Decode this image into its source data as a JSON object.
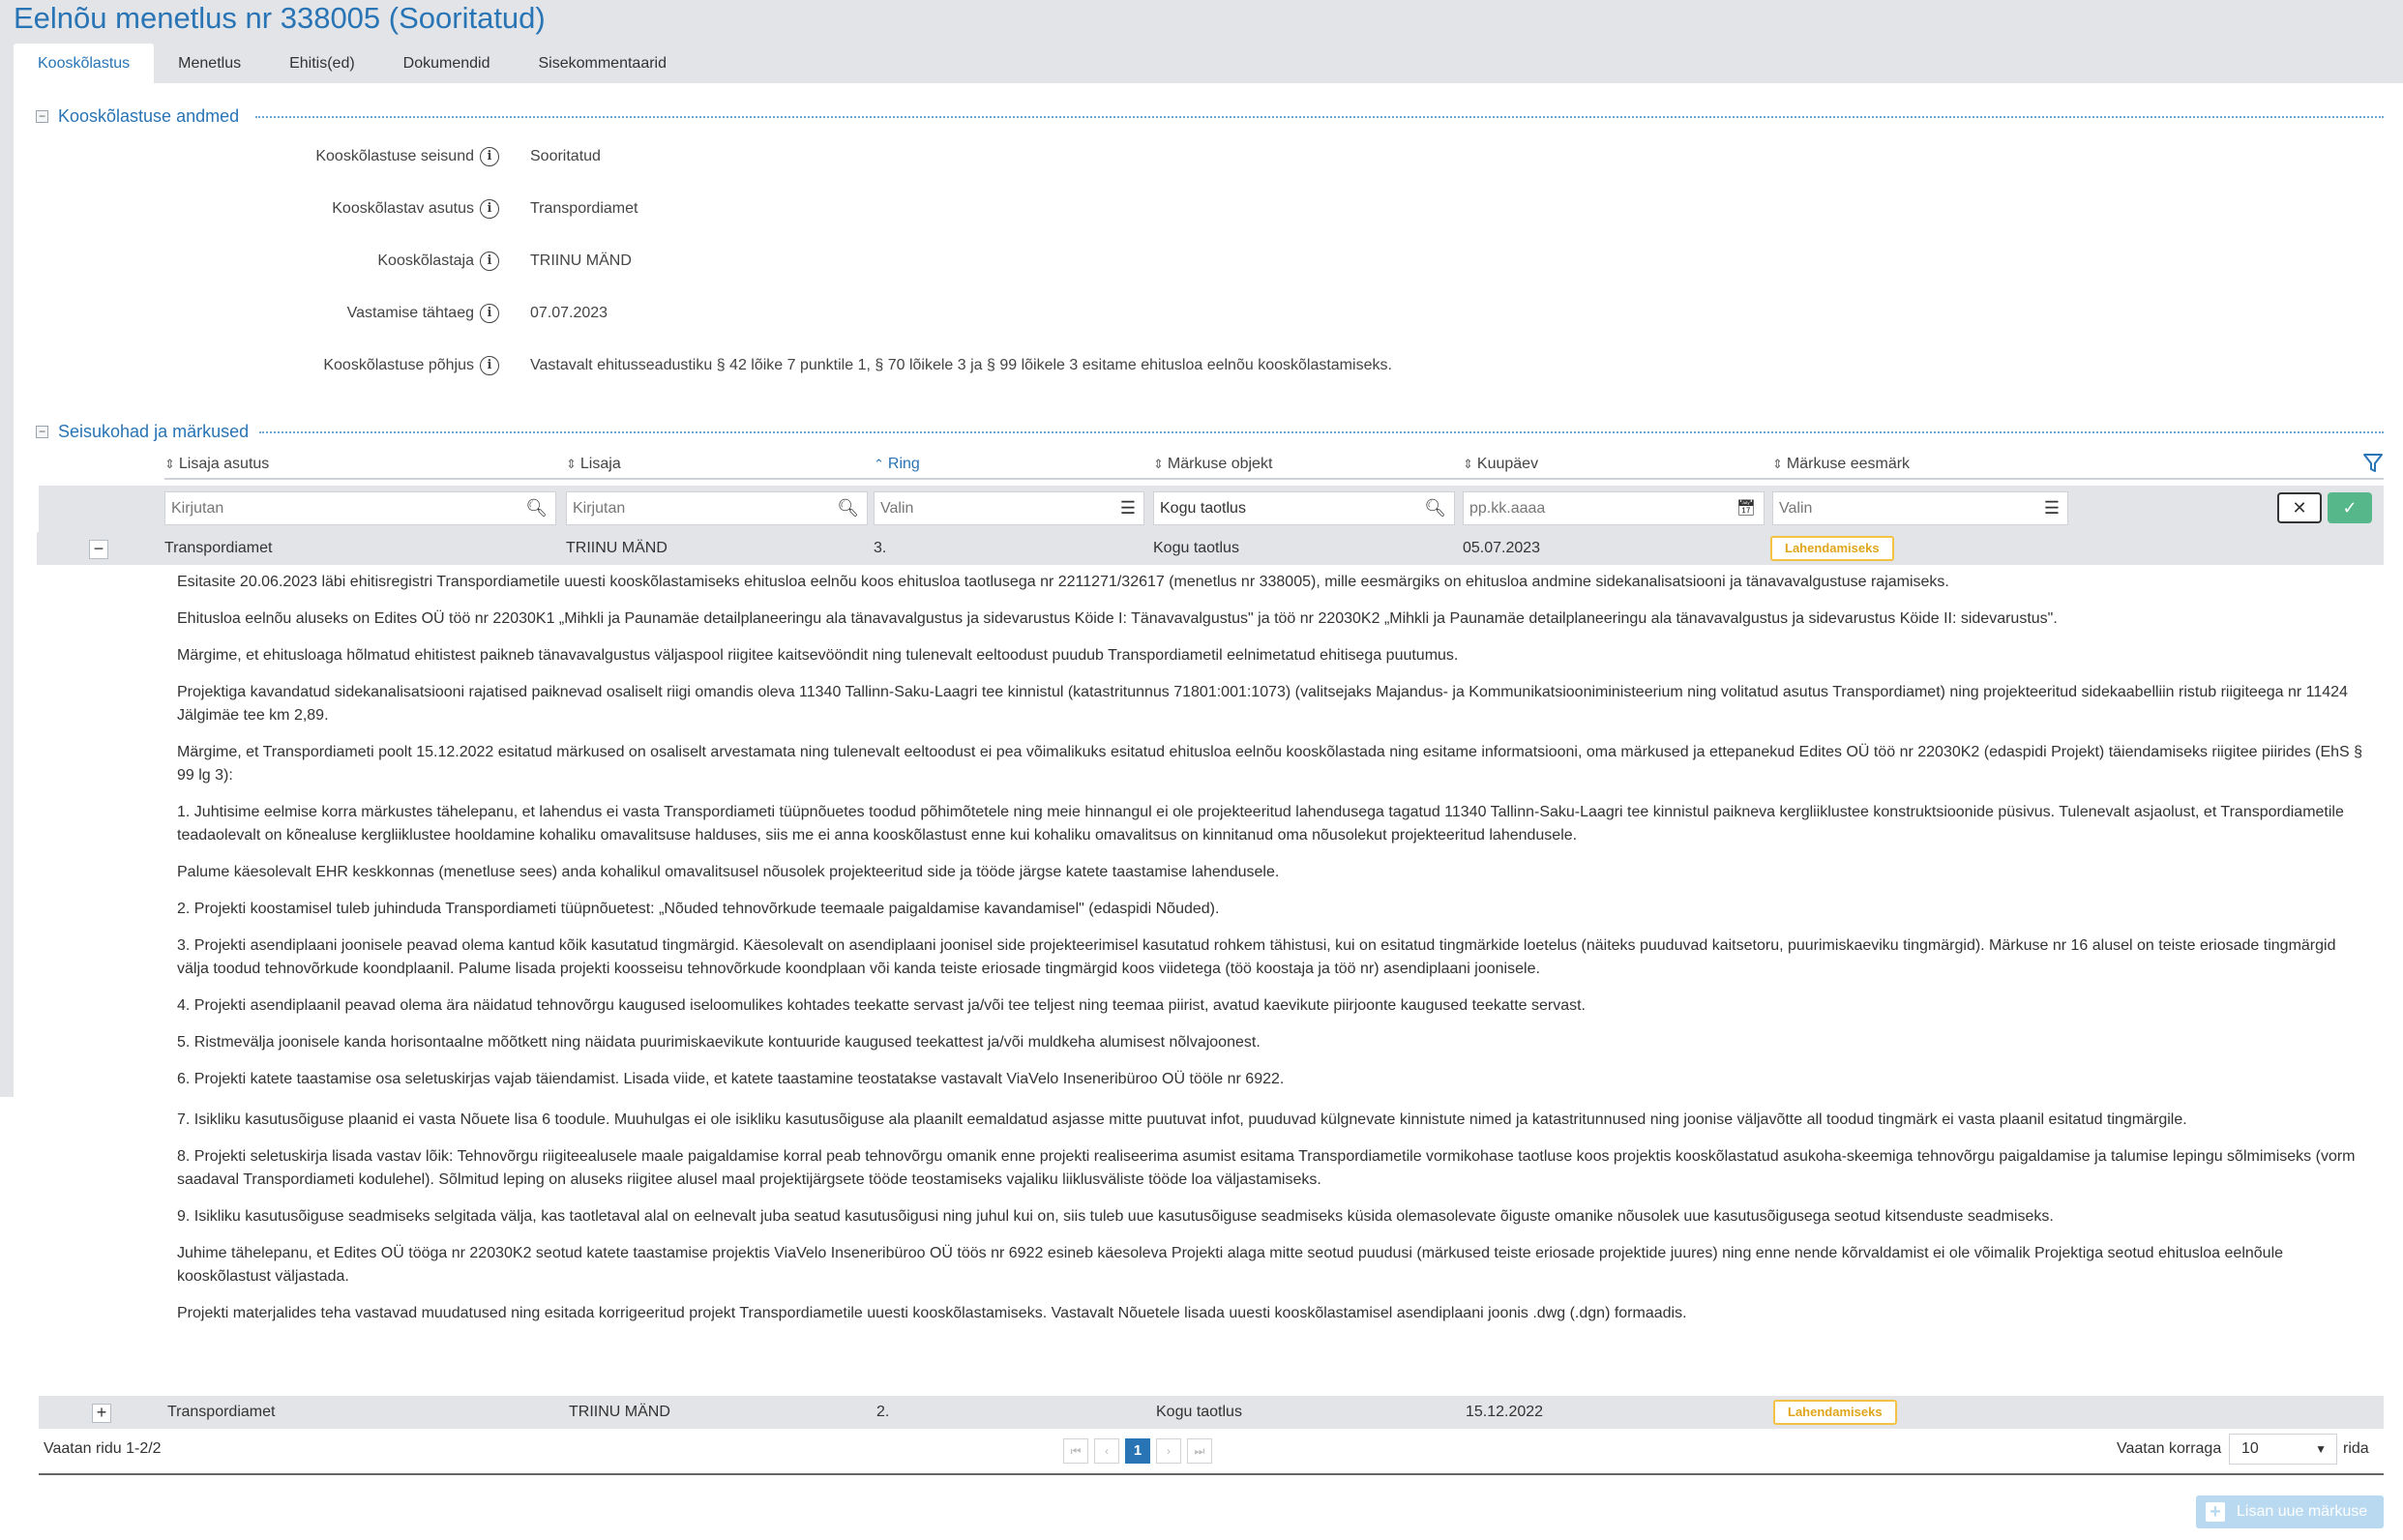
{
  "header": {
    "title": "Eelnõu menetlus nr 338005 (Sooritatud)",
    "tabs": [
      "Kooskõlastus",
      "Menetlus",
      "Ehitis(ed)",
      "Dokumendid",
      "Sisekommentaarid"
    ]
  },
  "section1": {
    "title": "Kooskõlastuse andmed",
    "toggle": "−",
    "fields": [
      {
        "label": "Kooskõlastuse seisund",
        "value": "Sooritatud"
      },
      {
        "label": "Kooskõlastav asutus",
        "value": "Transpordiamet"
      },
      {
        "label": "Kooskõlastaja",
        "value": "TRIINU MÄND"
      },
      {
        "label": "Vastamise tähtaeg",
        "value": "07.07.2023"
      },
      {
        "label": "Kooskõlastuse põhjus",
        "value": "Vastavalt ehitusseadustiku § 42 lõike 7 punktile 1, § 70 lõikele 3 ja § 99 lõikele 3 esitame ehitusloa eelnõu kooskõlastamiseks."
      }
    ],
    "info_icon": "i"
  },
  "section2": {
    "title": "Seisukohad ja märkused",
    "toggle": "−",
    "columns": [
      {
        "label": "Lisaja asutus",
        "sort": "⇕"
      },
      {
        "label": "Lisaja",
        "sort": "⇕"
      },
      {
        "label": "Ring",
        "sort": "⌃"
      },
      {
        "label": "Märkuse objekt",
        "sort": "⇕"
      },
      {
        "label": "Kuupäev",
        "sort": "⇕"
      },
      {
        "label": "Märkuse eesmärk",
        "sort": "⇕"
      }
    ],
    "filters": [
      {
        "placeholder": "Kirjutan",
        "icon": "search-icon"
      },
      {
        "placeholder": "Kirjutan",
        "icon": "search-icon"
      },
      {
        "placeholder": "Valin",
        "icon": "list-icon"
      },
      {
        "placeholder": "Kogu taotlus",
        "icon": "search-icon"
      },
      {
        "placeholder": "pp.kk.aaaa",
        "icon": "calendar-icon"
      },
      {
        "placeholder": "Valin",
        "icon": "list-icon"
      }
    ],
    "rows": [
      {
        "toggle": "−",
        "asutus": "Transpordiamet",
        "lisaja": "TRIINU MÄND",
        "ring": "3.",
        "objekt": "Kogu taotlus",
        "kuupaev": "05.07.2023",
        "eesmark": "Lahendamiseks"
      },
      {
        "toggle": "+",
        "asutus": "Transpordiamet",
        "lisaja": "TRIINU MÄND",
        "ring": "2.",
        "objekt": "Kogu taotlus",
        "kuupaev": "15.12.2022",
        "eesmark": "Lahendamiseks"
      }
    ],
    "detail": [
      "Esitasite 20.06.2023 läbi ehitisregistri Transpordiametile uuesti kooskõlastamiseks ehitusloa eelnõu koos ehitusloa taotlusega nr 2211271/32617 (menetlus nr 338005), mille eesmärgiks on ehitusloa andmine sidekanalisatsiooni ja tänavavalgustuse rajamiseks.",
      "Ehitusloa eelnõu aluseks on Edites OÜ töö nr 22030K1 „Mihkli ja Paunamäe detailplaneeringu ala tänavavalgustus ja sidevarustus Köide I: Tänavavalgustus\" ja töö nr 22030K2 „Mihkli ja Paunamäe detailplaneeringu ala tänavavalgustus ja sidevarustus Köide II: sidevarustus\".",
      "Märgime, et ehitusloaga hõlmatud ehitistest paikneb tänavavalgustus väljaspool riigitee kaitsevööndit ning tulenevalt eeltoodust puudub Transpordiametil eelnimetatud ehitisega puutumus.",
      "Projektiga kavandatud sidekanalisatsiooni rajatised paiknevad osaliselt riigi omandis oleva 11340 Tallinn-Saku-Laagri tee kinnistul (katastritunnus 71801:001:1073) (valitsejaks Majandus- ja Kommunikatsiooniministeerium ning volitatud asutus Transpordiamet) ning projekteeritud sidekaabelliin ristub riigiteega nr 11424 Jälgimäe tee km 2,89.",
      "Märgime, et Transpordiameti poolt 15.12.2022 esitatud märkused on osaliselt arvestamata ning tulenevalt eeltoodust ei pea võimalikuks esitatud ehitusloa eelnõu kooskõlastada ning esitame informatsiooni, oma märkused ja ettepanekud Edites OÜ töö nr 22030K2 (edaspidi Projekt) täiendamiseks riigitee piirides (EhS § 99 lg 3):",
      "1. Juhtisime eelmise korra märkustes tähelepanu, et lahendus ei vasta Transpordiameti tüüpnõuetes toodud põhimõtetele ning meie hinnangul ei ole projekteeritud lahendusega tagatud 11340 Tallinn-Saku-Laagri tee kinnistul paikneva kergliiklustee konstruktsioonide püsivus. Tulenevalt asjaolust, et Transpordiametile teadaolevalt on kõnealuse kergliiklustee hooldamine kohaliku omavalitsuse halduses, siis me ei anna kooskõlastust enne kui kohaliku omavalitsus on kinnitanud oma nõusolekut projekteeritud lahendusele.",
      "Palume käesolevalt EHR keskkonnas (menetluse sees) anda kohalikul omavalitsusel nõusolek projekteeritud side ja tööde järgse katete taastamise lahendusele.",
      "2. Projekti koostamisel tuleb juhinduda Transpordiameti tüüpnõuetest: „Nõuded tehnovõrkude teemaale paigaldamise kavandamisel\" (edaspidi Nõuded).",
      "3. Projekti asendiplaani joonisele peavad olema kantud kõik kasutatud tingmärgid. Käesolevalt on asendiplaani joonisel side projekteerimisel kasutatud rohkem tähistusi, kui on esitatud tingmärkide loetelus (näiteks puuduvad kaitsetoru, puurimiskaeviku tingmärgid). Märkuse nr 16 alusel on teiste eriosade tingmärgid välja toodud tehnovõrkude koondplaanil. Palume lisada projekti koosseisu tehnovõrkude koondplaan või kanda teiste eriosade tingmärgid koos viidetega (töö koostaja ja töö nr) asendiplaani joonisele.",
      "4. Projekti asendiplaanil peavad olema ära näidatud tehnovõrgu kaugused iseloomulikes kohtades teekatte servast ja/või tee teljest ning teemaa piirist, avatud kaevikute piirjoonte kaugused teekatte servast.",
      "5. Ristmevälja joonisele kanda horisontaalne mõõtkett ning näidata puurimiskaevikute kontuuride kaugused teekattest ja/või muldkeha alumisest nõlvajoonest.",
      "6. Projekti katete taastamise osa seletuskirjas vajab täiendamist. Lisada viide, et katete taastamine teostatakse vastavalt ViaVelo Inseneribüroo OÜ tööle nr 6922.",
      "7. Isikliku kasutusõiguse plaanid ei vasta Nõuete lisa 6 toodule. Muuhulgas ei ole isikliku kasutusõiguse ala plaanilt eemaldatud asjasse mitte puutuvat infot, puuduvad külgnevate kinnistute nimed ja katastritunnused ning joonise väljavõtte all toodud tingmärk ei vasta plaanil esitatud tingmärgile.",
      "8. Projekti seletuskirja lisada vastav lõik: Tehnovõrgu riigiteealusele maale paigaldamise korral peab tehnovõrgu omanik enne projekti realiseerima asumist esitama Transpordiametile vormikohase taotluse koos projektis kooskõlastatud asukoha-skeemiga tehnovõrgu paigaldamise ja talumise lepingu sõlmimiseks (vorm saadaval Transpordiameti kodulehel). Sõlmitud leping on aluseks riigitee alusel maal projektijärgsete tööde teostamiseks vajaliku liiklusväliste tööde loa väljastamiseks.",
      "9. Isikliku kasutusõiguse seadmiseks selgitada välja, kas taotletaval alal on eelnevalt juba seatud kasutusõigusi ning juhul kui on, siis tuleb uue kasutusõiguse seadmiseks küsida olemasolevate õiguste omanike nõusolek uue kasutusõigusega seotud kitsenduste seadmiseks.",
      "Juhime tähelepanu, et Edites OÜ tööga nr 22030K2 seotud katete taastamise projektis ViaVelo Inseneribüroo OÜ töös nr 6922 esineb käesoleva Projekti alaga mitte seotud puudusi (märkused teiste eriosade projektide juures) ning enne nende kõrvaldamist ei ole võimalik Projektiga seotud ehitusloa eelnõule kooskõlastust väljastada.",
      "Projekti materjalides teha vastavad muudatused ning esitada korrigeeritud projekt Transpordiametile uuesti kooskõlastamiseks. Vastavalt Nõuetele lisada uuesti kooskõlastamisel asendiplaani joonis .dwg (.dgn) formaadis."
    ],
    "footer": {
      "rows_info": "Vaatan ridu 1-2/2",
      "page_current": "1",
      "per_page_label": "Vaatan korraga",
      "per_page_value": "10",
      "per_page_suffix": "rida",
      "add_button": "Lisan uue märkuse"
    }
  },
  "colors": {
    "accent": "#2874b5",
    "badge": "#f3c242",
    "ok": "#56b88a",
    "bar": "#e2e4e7"
  }
}
